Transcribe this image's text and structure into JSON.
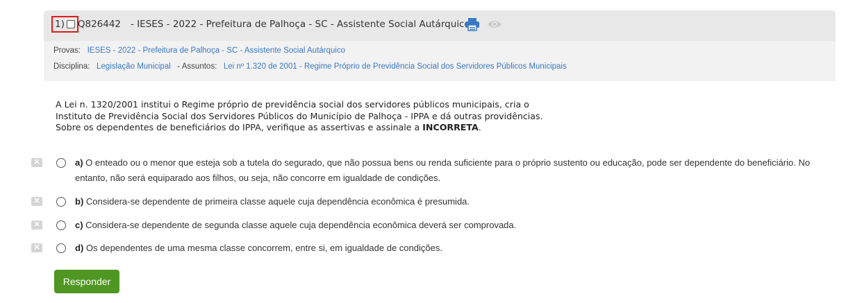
{
  "question": {
    "number": "1)",
    "code": "Q826442",
    "title": "- IESES - 2022 - Prefeitura de Palhoça - SC - Assistente Social Autárquico",
    "provas_label": "Provas:",
    "provas_value": "IESES - 2022 - Prefeitura de Palhoça - SC - Assistente Social Autárquico",
    "disciplina_label": "Disciplina:",
    "disciplina_value": "Legislação Municipal",
    "assuntos_label": "- Assuntos:",
    "assuntos_value": "Lei nº 1.320 de 2001 - Regime Próprio de Previdência Social dos Servidores Públicos Municipais"
  },
  "statement": {
    "line1": "A Lei n. 1320/2001 institui o Regime próprio de previdência social dos servidores públicos municipais, cria o",
    "line2": "Instituto de Previdência Social dos Servidores Públicos do Município de Palhoça - IPPA e dá outras providências.",
    "line3_prefix": "Sobre os dependentes de beneficiários do IPPA, verifique as assertivas e assinale a ",
    "line3_bold": "INCORRETA",
    "line3_suffix": "."
  },
  "alternatives": [
    {
      "letter": "a)",
      "text": " O enteado ou o menor que esteja sob a tutela do segurado, que não possua bens ou renda suficiente para o próprio sustento ou educação, pode ser dependente do beneficiário. No entanto, não será equiparado aos filhos, ou seja, não concorre em igualdade de condições."
    },
    {
      "letter": "b)",
      "text": " Considera-se dependente de primeira classe aquele cuja dependência econômica é presumida."
    },
    {
      "letter": "c)",
      "text": " Considera-se dependente de segunda classe aquele cuja dependência econômica deverá ser comprovada."
    },
    {
      "letter": "d)",
      "text": " Os dependentes de uma mesma classe concorrem, entre si, em igualdade de condições."
    }
  ],
  "submit_label": "Responder",
  "colors": {
    "accent": "#4f9722",
    "link": "#3a78c4",
    "icon": "#3a78c4"
  },
  "icons": [
    "print-icon",
    "eye-icon",
    "discard-x-icon"
  ]
}
